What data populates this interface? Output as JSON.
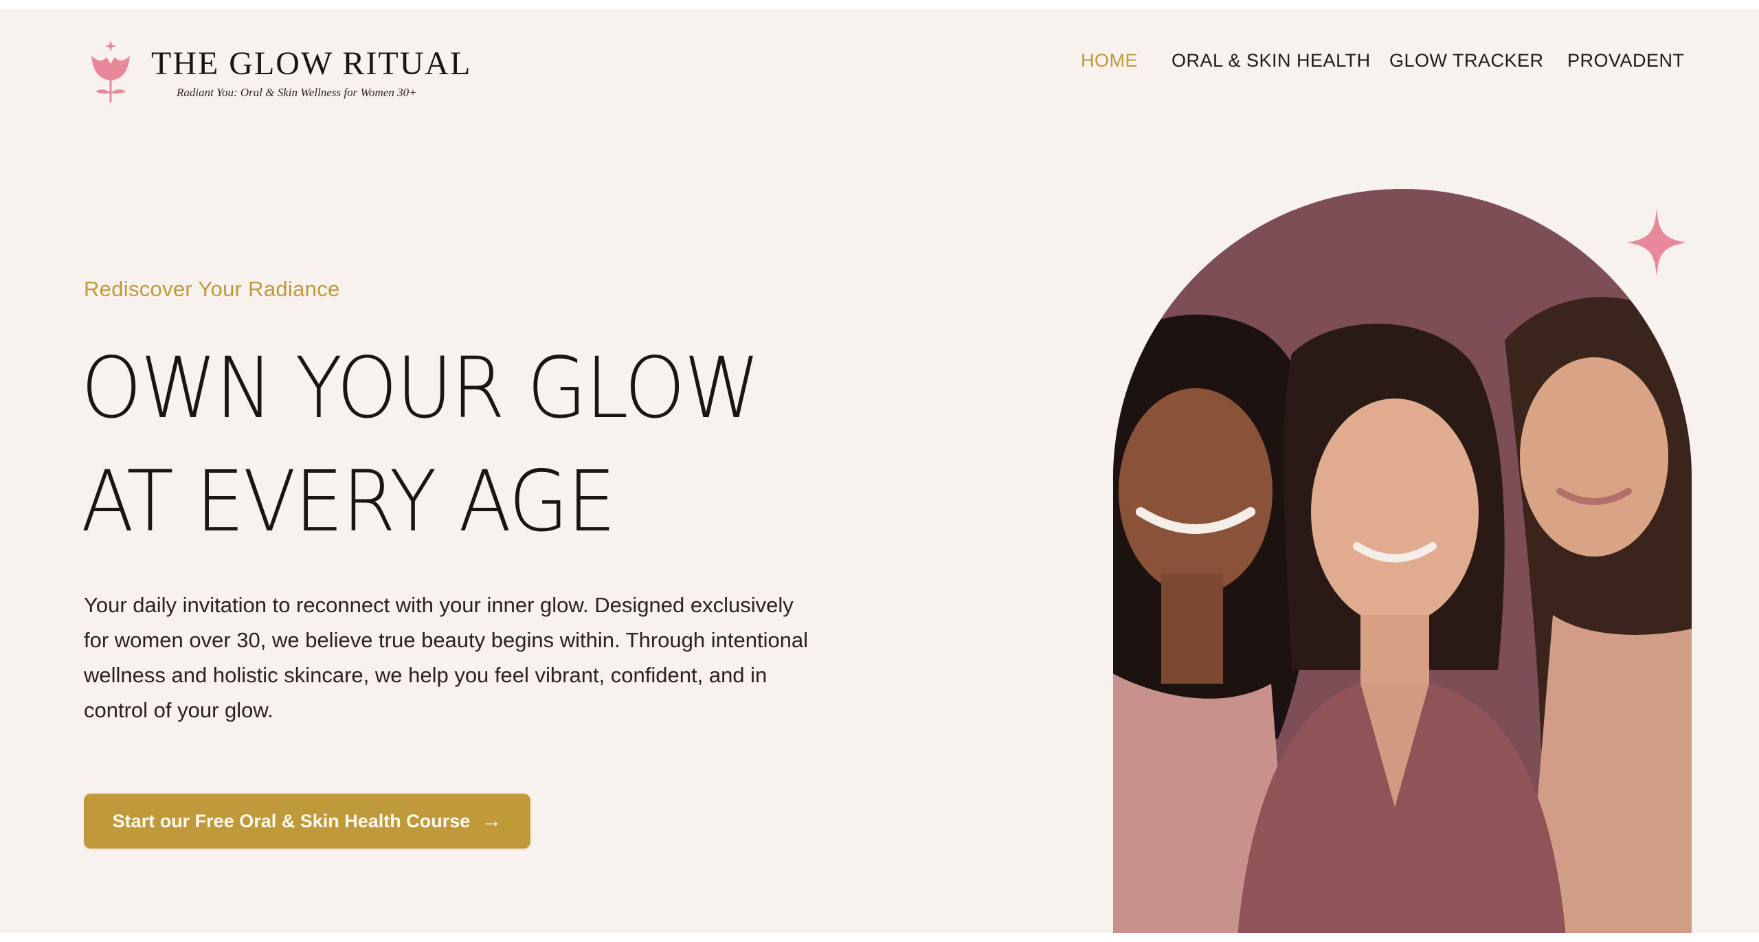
{
  "brand": {
    "title": "THE GLOW RITUAL",
    "tagline": "Radiant You: Oral & Skin Wellness for Women 30+",
    "logo_icon": "tulip-icon",
    "pink": "#e8899b"
  },
  "nav": {
    "items": [
      {
        "label": "HOME",
        "active": true
      },
      {
        "label": "ORAL & SKIN HEALTH",
        "active": false
      },
      {
        "label": "GLOW TRACKER",
        "active": false
      },
      {
        "label": "PROVADENT",
        "active": false
      }
    ]
  },
  "hero": {
    "eyebrow": "Rediscover Your Radiance",
    "headline_line1": "OWN YOUR GLOW",
    "headline_line2": "AT EVERY AGE",
    "body": "Your daily invitation to reconnect with your inner glow. Designed exclusively for women over 30, we believe true beauty begins within. Through intentional wellness and holistic skincare, we help you feel vibrant, confident, and in control of your glow.",
    "cta_label": "Start our Free Oral & Skin Health Course",
    "cta_icon": "arrow-right-icon",
    "image_subject": "three smiling women",
    "decor_icon": "sparkle-icon"
  },
  "colors": {
    "background": "#f7f2ed",
    "accent_gold": "#c0993a",
    "text_dark": "#1a1414",
    "arch_bg": "#7a4b51"
  }
}
